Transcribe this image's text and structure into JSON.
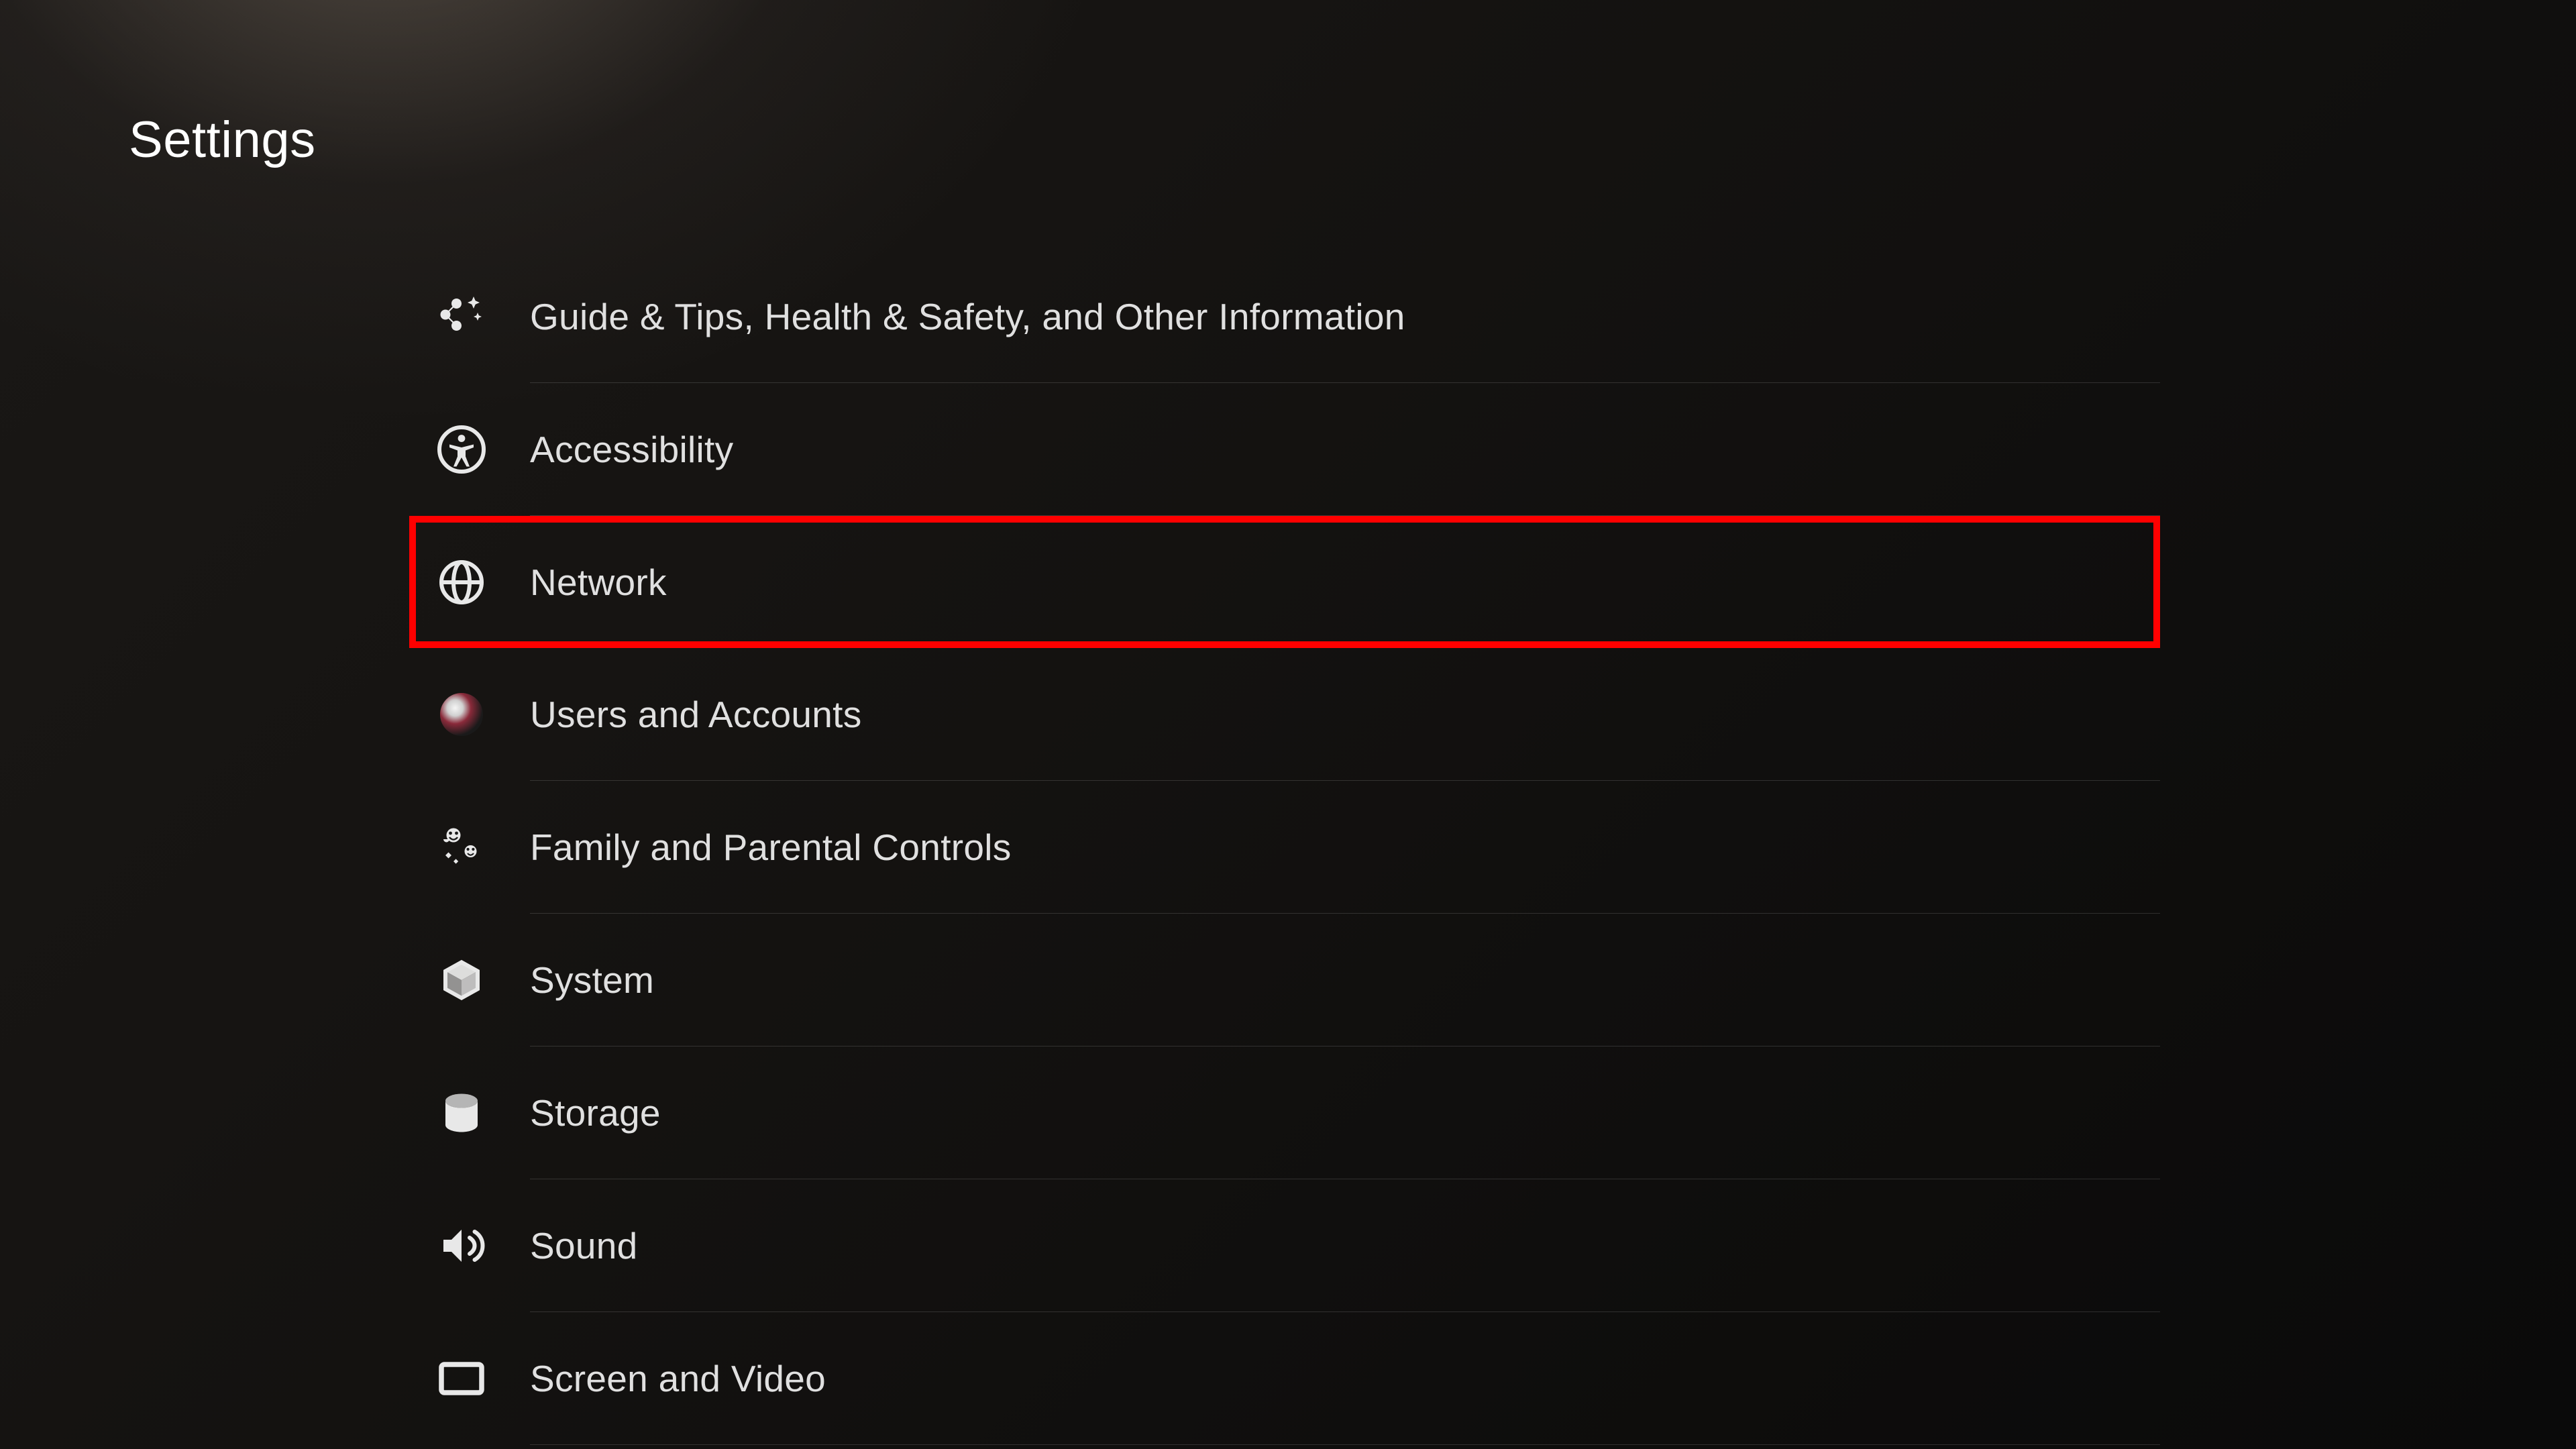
{
  "page": {
    "title": "Settings"
  },
  "menu": {
    "items": [
      {
        "label": "Guide & Tips, Health & Safety, and Other Information",
        "icon": "guide-tips-icon"
      },
      {
        "label": "Accessibility",
        "icon": "accessibility-icon"
      },
      {
        "label": "Network",
        "icon": "globe-icon",
        "highlighted": true
      },
      {
        "label": "Users and Accounts",
        "icon": "avatar-icon"
      },
      {
        "label": "Family and Parental Controls",
        "icon": "family-icon"
      },
      {
        "label": "System",
        "icon": "cube-icon"
      },
      {
        "label": "Storage",
        "icon": "storage-icon"
      },
      {
        "label": "Sound",
        "icon": "sound-icon"
      },
      {
        "label": "Screen and Video",
        "icon": "screen-icon"
      }
    ]
  }
}
